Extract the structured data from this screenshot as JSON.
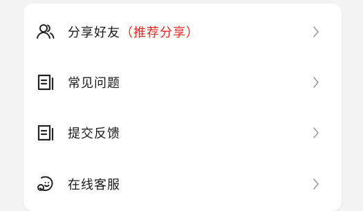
{
  "menu": {
    "items": [
      {
        "label": "分享好友",
        "highlight": "（推荐分享）",
        "icon": "users-icon"
      },
      {
        "label": "常见问题",
        "highlight": "",
        "icon": "document-icon"
      },
      {
        "label": "提交反馈",
        "highlight": "",
        "icon": "document-icon"
      },
      {
        "label": "在线客服",
        "highlight": "",
        "icon": "chat-smile-icon"
      }
    ]
  },
  "colors": {
    "highlight": "#e8271f",
    "text": "#1a1a1a",
    "chevron": "#9a9a9a"
  }
}
